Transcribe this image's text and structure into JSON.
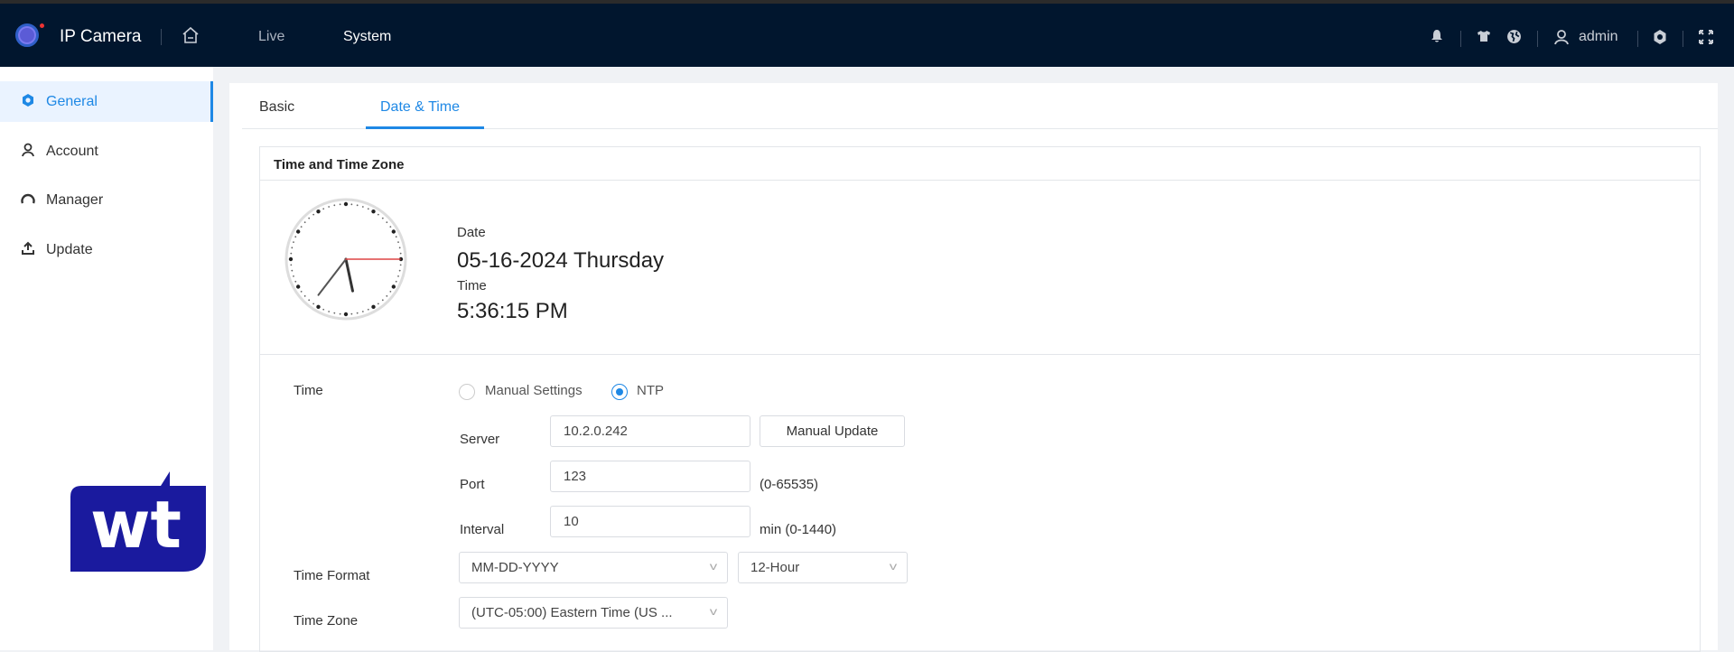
{
  "header": {
    "app_title": "IP Camera",
    "nav": [
      {
        "label": "Live"
      },
      {
        "label": "System"
      }
    ],
    "user": "admin",
    "icons": [
      "camera-logo-icon",
      "home-icon",
      "bell-icon",
      "shirt-icon",
      "globe-icon",
      "user-icon",
      "settings-icon",
      "fullscreen-icon"
    ]
  },
  "sidebar": {
    "items": [
      {
        "label": "General",
        "icon": "gear-icon",
        "active": true
      },
      {
        "label": "Account",
        "icon": "user-icon"
      },
      {
        "label": "Manager",
        "icon": "gauge-icon"
      },
      {
        "label": "Update",
        "icon": "upload-icon"
      }
    ]
  },
  "tabs": [
    {
      "label": "Basic"
    },
    {
      "label": "Date & Time",
      "active": true
    }
  ],
  "section": {
    "title": "Time and Time Zone",
    "date_label": "Date",
    "date_value": "05-16-2024 Thursday",
    "time_label": "Time",
    "time_value": "5:36:15 PM",
    "form": {
      "time_label": "Time",
      "mode_options": [
        "Manual Settings",
        "NTP"
      ],
      "mode_selected": "NTP",
      "server_label": "Server",
      "server_value": "10.2.0.242",
      "manual_update": "Manual Update",
      "port_label": "Port",
      "port_value": "123",
      "port_hint": "(0-65535)",
      "interval_label": "Interval",
      "interval_value": "10",
      "interval_hint": "min (0-1440)",
      "format_label": "Time Format",
      "date_format": "MM-DD-YYYY",
      "hour_format": "12-Hour",
      "zone_label": "Time Zone",
      "zone_value": "(UTC-05:00) Eastern Time (US ..."
    }
  },
  "colors": {
    "accent": "#1e88e5",
    "header_bg": "#01162e",
    "watermark": "#1a1a9e"
  },
  "watermark": {
    "text": "wt"
  }
}
